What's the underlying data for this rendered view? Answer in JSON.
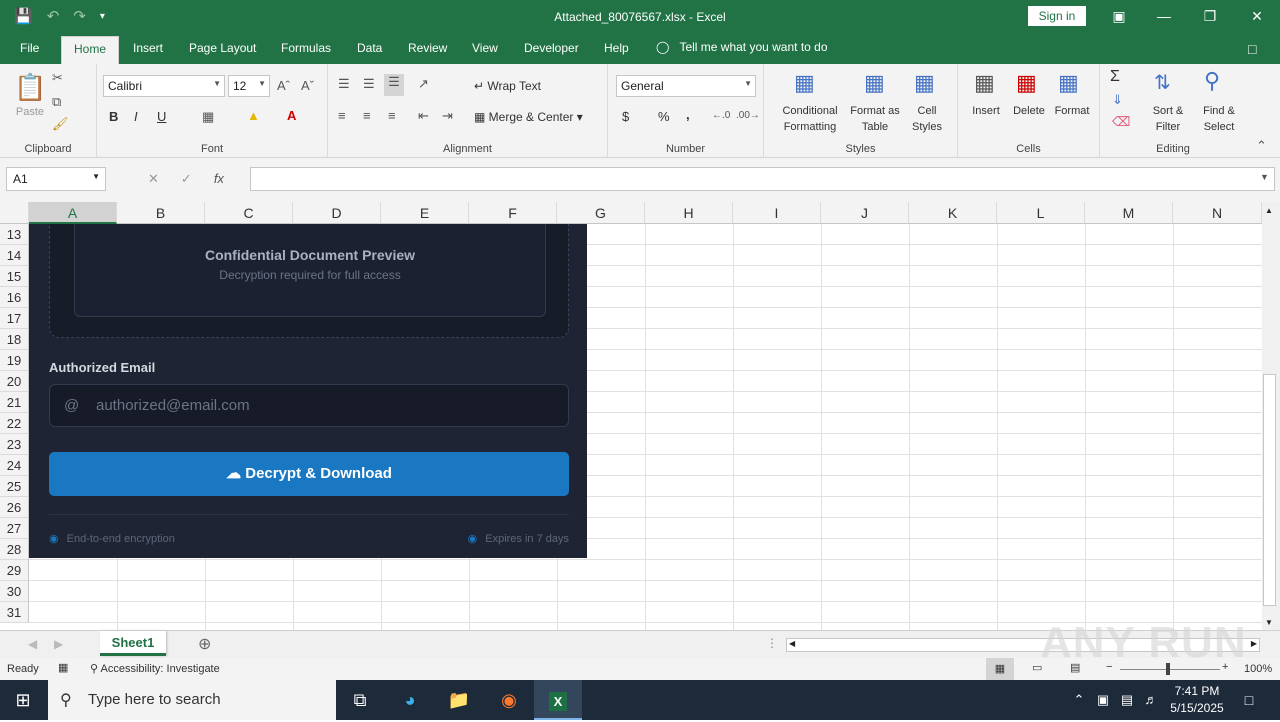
{
  "window": {
    "title": "Attached_80076567.xlsx  -  Excel",
    "sign_in": "Sign in",
    "controls": [
      "ribbon-display-icon",
      "minimize-icon",
      "maximize-icon",
      "close-icon"
    ]
  },
  "ribbon_tabs": [
    "File",
    "Home",
    "Insert",
    "Page Layout",
    "Formulas",
    "Data",
    "Review",
    "View",
    "Developer",
    "Help"
  ],
  "active_tab": "Home",
  "tell_me": "Tell me what you want to do",
  "ribbon": {
    "clipboard": {
      "label": "Clipboard",
      "paste": "Paste"
    },
    "font": {
      "label": "Font",
      "name": "Calibri",
      "size": "12",
      "bold": "B",
      "italic": "I",
      "underline": "U"
    },
    "alignment": {
      "label": "Alignment",
      "wrap_text": "Wrap Text",
      "merge_center": "Merge & Center"
    },
    "number": {
      "label": "Number",
      "format": "General",
      "currency": "$",
      "percent": "%",
      "comma": ","
    },
    "styles": {
      "label": "Styles",
      "conditional": "Conditional",
      "conditional2": "Formatting",
      "format_table": "Format as",
      "format_table2": "Table",
      "cell_styles": "Cell",
      "cell_styles2": "Styles"
    },
    "cells": {
      "label": "Cells",
      "insert": "Insert",
      "delete": "Delete",
      "format": "Format"
    },
    "editing": {
      "label": "Editing",
      "sort": "Sort &",
      "sort2": "Filter",
      "find": "Find &",
      "find2": "Select"
    }
  },
  "formula_bar": {
    "name_box": "A1",
    "fx": "fx",
    "value": ""
  },
  "columns": [
    "A",
    "B",
    "C",
    "D",
    "E",
    "F",
    "G",
    "H",
    "I",
    "J",
    "K",
    "L",
    "M",
    "N"
  ],
  "rows": [
    "13",
    "14",
    "15",
    "16",
    "17",
    "18",
    "19",
    "20",
    "21",
    "22",
    "23",
    "24",
    "25",
    "26",
    "27",
    "28",
    "29",
    "30",
    "31"
  ],
  "overlay": {
    "preview_title": "Confidential Document Preview",
    "preview_subtitle": "Decryption required for full access",
    "email_label": "Authorized Email",
    "email_placeholder": "authorized@email.com",
    "button_label": "Decrypt & Download",
    "footer_left": "End-to-end encryption",
    "footer_right": "Expires in 7 days",
    "accent_color": "#1a78c2"
  },
  "sheet": {
    "tab": "Sheet1"
  },
  "status": {
    "ready": "Ready",
    "accessibility": "Accessibility: Investigate",
    "zoom": "100%"
  },
  "taskbar": {
    "search_placeholder": "Type here to search",
    "time": "7:41 PM",
    "date": "5/15/2025"
  },
  "watermark": "ANY RUN"
}
